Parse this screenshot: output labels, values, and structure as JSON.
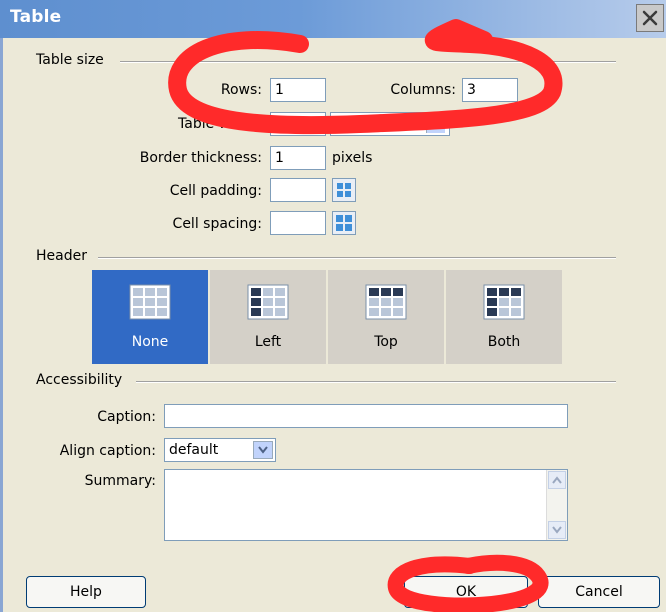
{
  "window": {
    "title": "Table",
    "close_icon": "close-icon"
  },
  "table_size": {
    "legend": "Table size",
    "rows_label": "Rows:",
    "rows_value": "1",
    "columns_label": "Columns:",
    "columns_value": "3",
    "table_width_label": "Table width:",
    "table_width_value": "",
    "table_width_unit": "pixels",
    "border_label": "Border thickness:",
    "border_value": "1",
    "border_unit": "pixels",
    "padding_label": "Cell padding:",
    "padding_value": "",
    "spacing_label": "Cell spacing:",
    "spacing_value": ""
  },
  "header": {
    "legend": "Header",
    "options": [
      {
        "label": "None",
        "selected": true
      },
      {
        "label": "Left",
        "selected": false
      },
      {
        "label": "Top",
        "selected": false
      },
      {
        "label": "Both",
        "selected": false
      }
    ]
  },
  "accessibility": {
    "legend": "Accessibility",
    "caption_label": "Caption:",
    "caption_value": "",
    "align_label": "Align caption:",
    "align_value": "default",
    "summary_label": "Summary:",
    "summary_value": ""
  },
  "buttons": {
    "help": "Help",
    "ok": "OK",
    "cancel": "Cancel"
  },
  "colors": {
    "titlebar": "#6c9bd8",
    "selected_header": "#316ac5",
    "annotation_red": "#ff2a2a"
  }
}
